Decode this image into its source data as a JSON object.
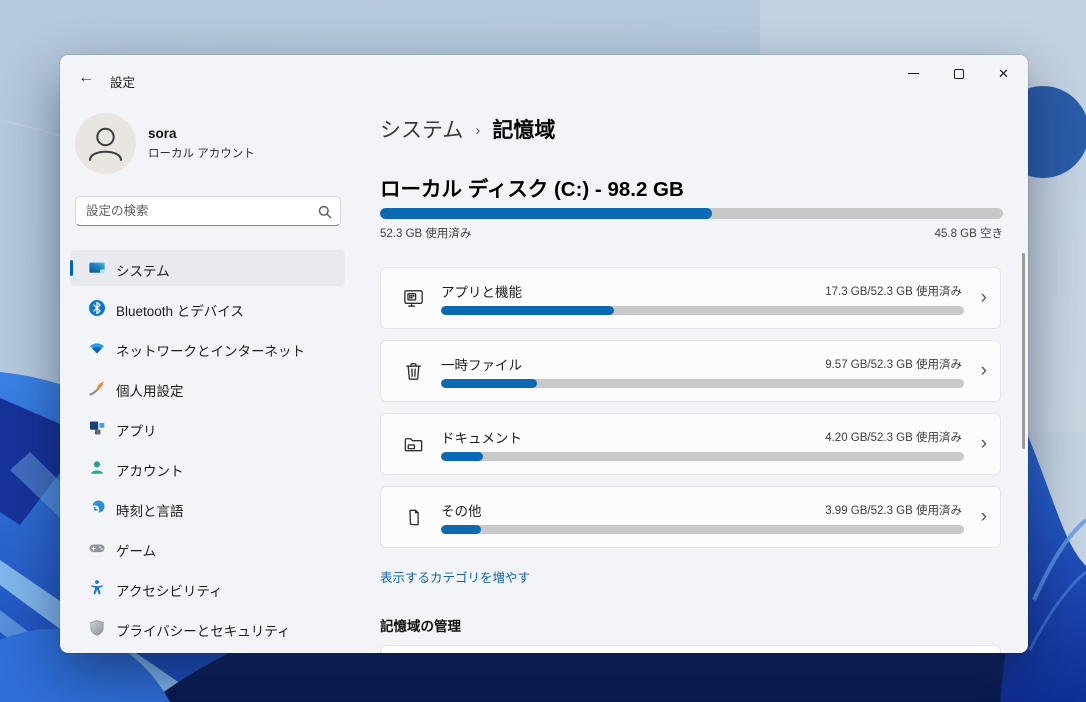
{
  "window": {
    "title": "設定"
  },
  "titlebar": {
    "back_glyph": "←"
  },
  "user": {
    "name": "sora",
    "account_type": "ローカル アカウント"
  },
  "search": {
    "placeholder": "設定の検索"
  },
  "sidebar": {
    "items": [
      {
        "label": "システム",
        "icon": "system-icon",
        "selected": true
      },
      {
        "label": "Bluetooth とデバイス",
        "icon": "bluetooth-icon",
        "selected": false
      },
      {
        "label": "ネットワークとインターネット",
        "icon": "network-icon",
        "selected": false
      },
      {
        "label": "個人用設定",
        "icon": "personalization-icon",
        "selected": false
      },
      {
        "label": "アプリ",
        "icon": "apps-icon",
        "selected": false
      },
      {
        "label": "アカウント",
        "icon": "accounts-icon",
        "selected": false
      },
      {
        "label": "時刻と言語",
        "icon": "time-language-icon",
        "selected": false
      },
      {
        "label": "ゲーム",
        "icon": "gaming-icon",
        "selected": false
      },
      {
        "label": "アクセシビリティ",
        "icon": "accessibility-icon",
        "selected": false
      },
      {
        "label": "プライバシーとセキュリティ",
        "icon": "privacy-icon",
        "selected": false
      }
    ]
  },
  "breadcrumb": {
    "parent": "システム",
    "separator": "›",
    "current": "記憶域"
  },
  "disk": {
    "title": "ローカル ディスク (C:) - 98.2 GB",
    "used_label": "52.3 GB 使用済み",
    "free_label": "45.8 GB 空き",
    "used_percent": 53.3
  },
  "categories": [
    {
      "label": "アプリと機能",
      "usage": "17.3 GB/52.3 GB 使用済み",
      "percent": 33.1,
      "icon": "apps-features-icon"
    },
    {
      "label": "一時ファイル",
      "usage": "9.57 GB/52.3 GB 使用済み",
      "percent": 18.3,
      "icon": "temp-files-icon"
    },
    {
      "label": "ドキュメント",
      "usage": "4.20 GB/52.3 GB 使用済み",
      "percent": 8.0,
      "icon": "documents-icon"
    },
    {
      "label": "その他",
      "usage": "3.99 GB/52.3 GB 使用済み",
      "percent": 7.6,
      "icon": "other-icon"
    }
  ],
  "links": {
    "show_more_categories": "表示するカテゴリを増やす"
  },
  "sections": {
    "storage_management": "記憶域の管理"
  },
  "glyphs": {
    "chevron_right": "›",
    "close": "✕"
  },
  "colors": {
    "accent_bar": "#0b69b4",
    "selection_pill": "#0067c0",
    "link": "#0e63b3",
    "track": "#c7c7c7",
    "window_bg": "#f2f4f8"
  }
}
